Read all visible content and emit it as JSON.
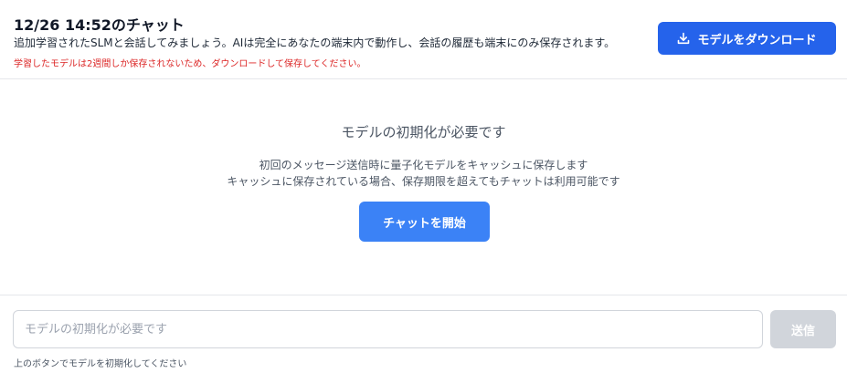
{
  "header": {
    "title": "12/26 14:52のチャット",
    "description": "追加学習されたSLMと会話してみましょう。AIは完全にあなたの端末内で動作し、会話の履歴も端末にのみ保存されます。",
    "warning": "学習したモデルは2週間しか保存されないため、ダウンロードして保存してください。",
    "download_label": "モデルをダウンロード",
    "download_icon": "download-icon",
    "accent_color": "#2563eb",
    "warning_color": "#dc2626"
  },
  "main": {
    "heading": "モデルの初期化が必要です",
    "message_line1": "初回のメッセージ送信時に量子化モデルをキャッシュに保存します",
    "message_line2": "キャッシュに保存されている場合、保存期限を超えてもチャットは利用可能です",
    "start_label": "チャットを開始"
  },
  "composer": {
    "placeholder": "モデルの初期化が必要です",
    "value": "",
    "send_label": "送信",
    "hint": "上のボタンでモデルを初期化してください"
  }
}
